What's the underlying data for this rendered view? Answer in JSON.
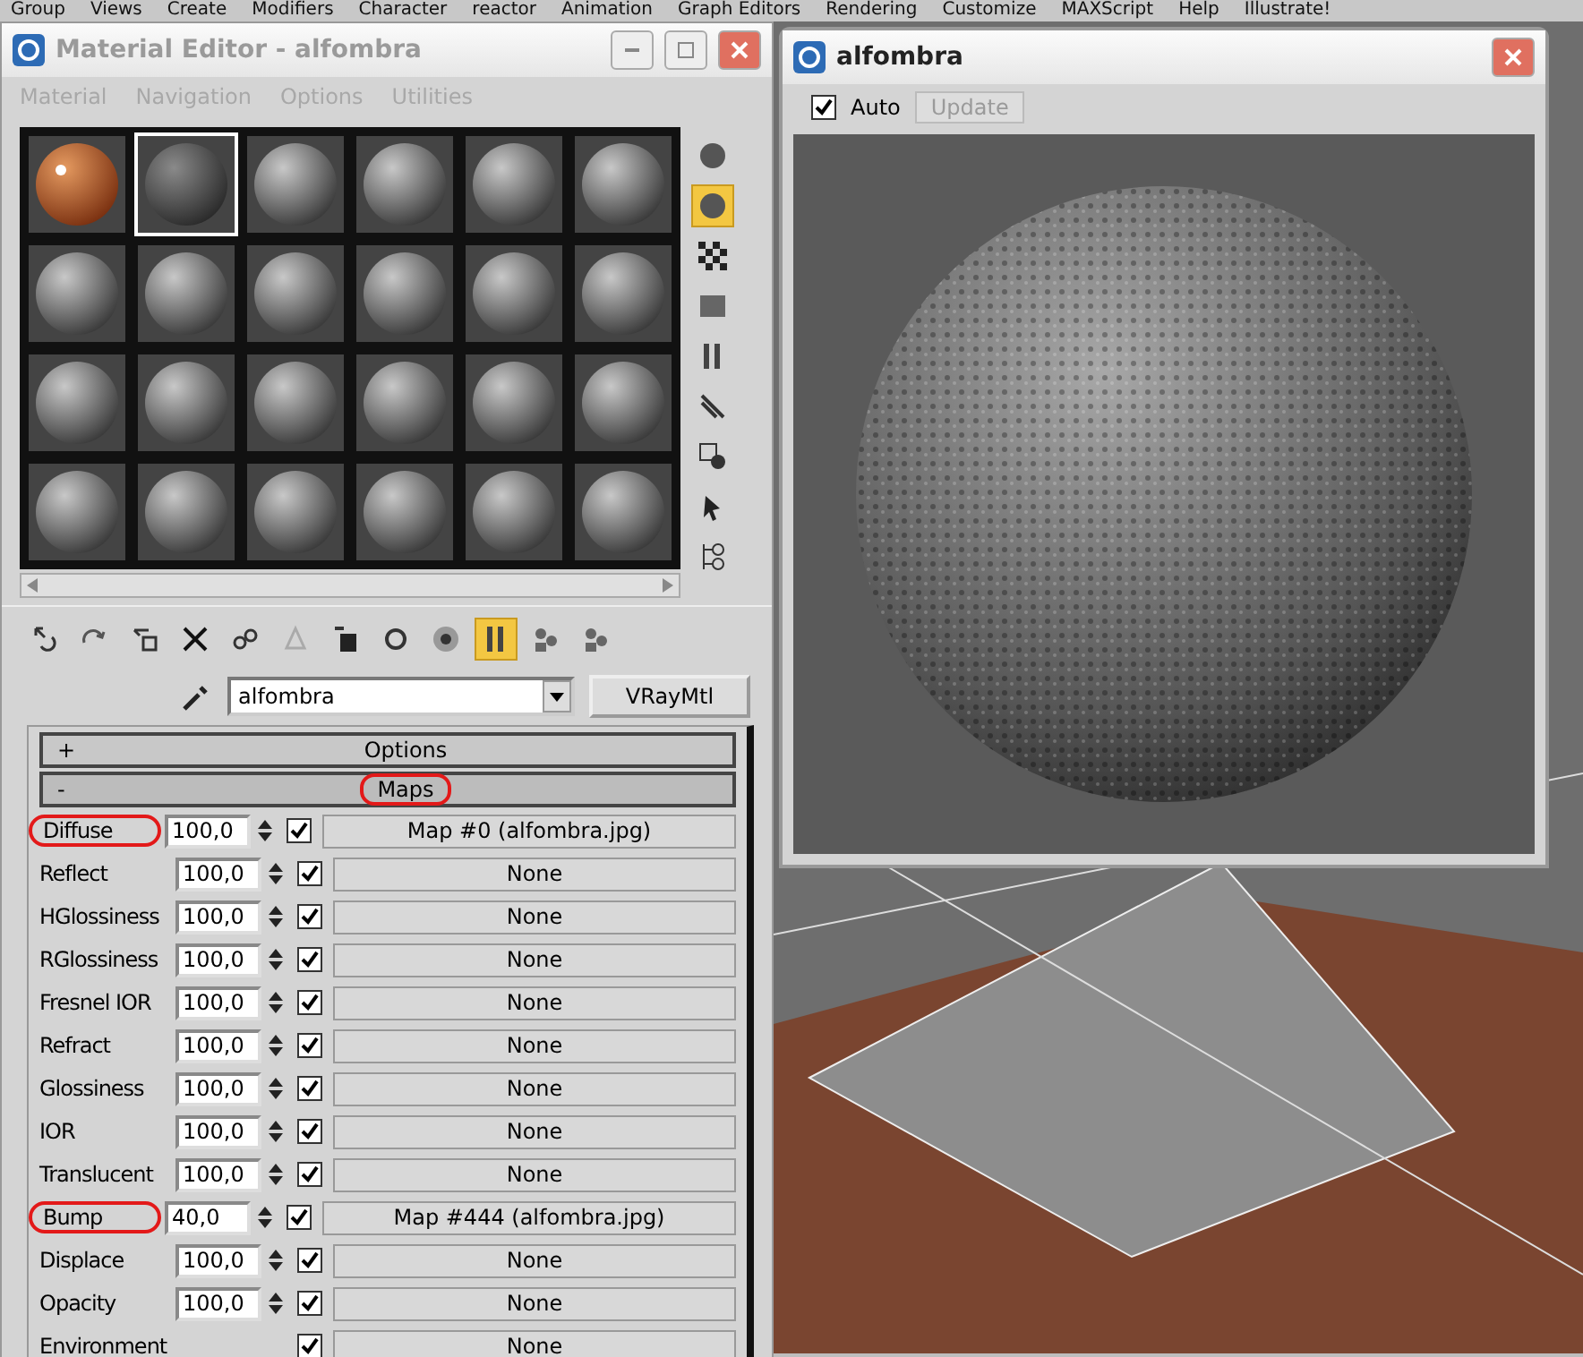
{
  "menu_bar": [
    "Group",
    "Views",
    "Create",
    "Modifiers",
    "Character",
    "reactor",
    "Animation",
    "Graph Editors",
    "Rendering",
    "Customize",
    "MAXScript",
    "Help",
    "Illustrate!"
  ],
  "material_editor": {
    "title": "Material Editor - alfombra",
    "menu": [
      {
        "label": "Material",
        "disabled": true
      },
      {
        "label": "Navigation",
        "disabled": true
      },
      {
        "label": "Options",
        "disabled": true
      },
      {
        "label": "Utilities",
        "disabled": true
      }
    ],
    "slots": [
      {
        "kind": "glossy",
        "selected": false
      },
      {
        "kind": "rough",
        "selected": true
      },
      {
        "kind": "plain",
        "selected": false
      },
      {
        "kind": "plain",
        "selected": false
      },
      {
        "kind": "plain",
        "selected": false
      },
      {
        "kind": "plain",
        "selected": false
      },
      {
        "kind": "plain",
        "selected": false
      },
      {
        "kind": "plain",
        "selected": false
      },
      {
        "kind": "plain",
        "selected": false
      },
      {
        "kind": "plain",
        "selected": false
      },
      {
        "kind": "plain",
        "selected": false
      },
      {
        "kind": "plain",
        "selected": false
      },
      {
        "kind": "plain",
        "selected": false
      },
      {
        "kind": "plain",
        "selected": false
      },
      {
        "kind": "plain",
        "selected": false
      },
      {
        "kind": "plain",
        "selected": false
      },
      {
        "kind": "plain",
        "selected": false
      },
      {
        "kind": "plain",
        "selected": false
      },
      {
        "kind": "plain",
        "selected": false
      },
      {
        "kind": "plain",
        "selected": false
      },
      {
        "kind": "plain",
        "selected": false
      },
      {
        "kind": "plain",
        "selected": false
      },
      {
        "kind": "plain",
        "selected": false
      },
      {
        "kind": "plain",
        "selected": false
      }
    ],
    "side_tools": [
      {
        "kind": "sphere",
        "active": false
      },
      {
        "kind": "sphere",
        "active": true
      },
      {
        "kind": "checker",
        "active": false
      },
      {
        "kind": "square",
        "active": false
      },
      {
        "kind": "bars",
        "active": false
      },
      {
        "kind": "film",
        "active": false
      },
      {
        "kind": "shapes",
        "active": false
      },
      {
        "kind": "pick",
        "active": false
      },
      {
        "kind": "nodes",
        "active": false
      }
    ],
    "bottom_tools": [
      {
        "kind": "get",
        "active": false
      },
      {
        "kind": "put",
        "active": false
      },
      {
        "kind": "assign",
        "active": false
      },
      {
        "kind": "delete",
        "active": false
      },
      {
        "kind": "link",
        "active": false
      },
      {
        "kind": "tree",
        "active": false
      },
      {
        "kind": "clipboard",
        "active": false
      },
      {
        "kind": "circle",
        "active": false
      },
      {
        "kind": "ball",
        "active": false
      },
      {
        "kind": "bars",
        "active": true
      },
      {
        "kind": "people",
        "active": false
      },
      {
        "kind": "people",
        "active": false
      }
    ],
    "material_name": "alfombra",
    "material_type": "VRayMtl",
    "rollouts": [
      {
        "sign": "+",
        "title": "Options",
        "expanded": false,
        "circled": false
      },
      {
        "sign": "-",
        "title": "Maps",
        "expanded": true,
        "circled": true
      }
    ],
    "maps": [
      {
        "label": "Diffuse",
        "value": "100,0",
        "enabled": true,
        "map": "Map #0 (alfombra.jpg)",
        "circled": true
      },
      {
        "label": "Reflect",
        "value": "100,0",
        "enabled": true,
        "map": "None",
        "circled": false
      },
      {
        "label": "HGlossiness",
        "value": "100,0",
        "enabled": true,
        "map": "None",
        "circled": false
      },
      {
        "label": "RGlossiness",
        "value": "100,0",
        "enabled": true,
        "map": "None",
        "circled": false
      },
      {
        "label": "Fresnel IOR",
        "value": "100,0",
        "enabled": true,
        "map": "None",
        "circled": false
      },
      {
        "label": "Refract",
        "value": "100,0",
        "enabled": true,
        "map": "None",
        "circled": false
      },
      {
        "label": "Glossiness",
        "value": "100,0",
        "enabled": true,
        "map": "None",
        "circled": false
      },
      {
        "label": "IOR",
        "value": "100,0",
        "enabled": true,
        "map": "None",
        "circled": false
      },
      {
        "label": "Translucent",
        "value": "100,0",
        "enabled": true,
        "map": "None",
        "circled": false
      },
      {
        "label": "Bump",
        "value": "40,0",
        "enabled": true,
        "map": "Map #444 (alfombra.jpg)",
        "circled": true
      },
      {
        "label": "Displace",
        "value": "100,0",
        "enabled": true,
        "map": "None",
        "circled": false
      },
      {
        "label": "Opacity",
        "value": "100,0",
        "enabled": true,
        "map": "None",
        "circled": false
      },
      {
        "label": "Environment",
        "enabled": true,
        "map": "None",
        "circled": false
      }
    ]
  },
  "preview_window": {
    "title": "alfombra",
    "auto": {
      "label": "Auto",
      "checked": true
    },
    "update": {
      "label": "Update",
      "disabled": true
    }
  }
}
